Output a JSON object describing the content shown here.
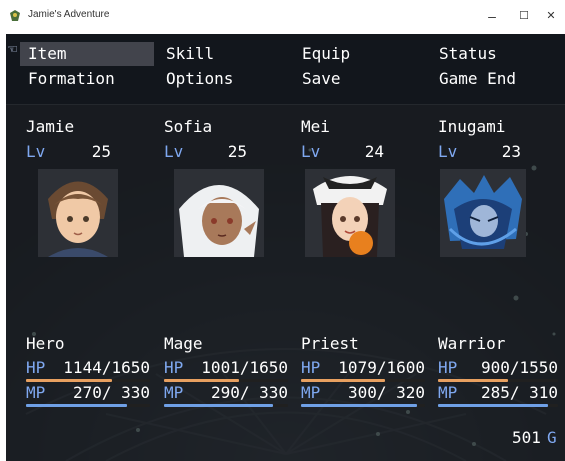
{
  "window": {
    "title": "Jamie's Adventure",
    "controls": {
      "minimize": "–",
      "maximize": "☐",
      "close": "✕"
    }
  },
  "commands": [
    {
      "label": "Item",
      "selected": true
    },
    {
      "label": "Skill",
      "selected": false
    },
    {
      "label": "Equip",
      "selected": false
    },
    {
      "label": "Status",
      "selected": false
    },
    {
      "label": "Formation",
      "selected": false
    },
    {
      "label": "Options",
      "selected": false
    },
    {
      "label": "Save",
      "selected": false
    },
    {
      "label": "Game End",
      "selected": false
    }
  ],
  "party": [
    {
      "name": "Jamie",
      "level_label": "Lv",
      "level": "25",
      "class": "Hero",
      "hp_label": "HP",
      "hp": "1144/1650",
      "mp_label": "MP",
      "mp": "270/ 330",
      "hp_fill": 0.693,
      "mp_fill": 0.818,
      "portrait": "jamie-portrait"
    },
    {
      "name": "Sofia",
      "level_label": "Lv",
      "level": "25",
      "class": "Mage",
      "hp_label": "HP",
      "hp": "1001/1650",
      "mp_label": "MP",
      "mp": "290/ 330",
      "hp_fill": 0.607,
      "mp_fill": 0.879,
      "portrait": "sofia-portrait"
    },
    {
      "name": "Mei",
      "level_label": "Lv",
      "level": "24",
      "class": "Priest",
      "hp_label": "HP",
      "hp": "1079/1600",
      "mp_label": "MP",
      "mp": "300/ 320",
      "hp_fill": 0.674,
      "mp_fill": 0.938,
      "portrait": "mei-portrait"
    },
    {
      "name": "Inugami",
      "level_label": "Lv",
      "level": "23",
      "class": "Warrior",
      "hp_label": "HP",
      "hp": "900/1550",
      "mp_label": "MP",
      "mp": "285/ 310",
      "hp_fill": 0.581,
      "mp_fill": 0.919,
      "portrait": "inugami-portrait"
    }
  ],
  "gold": {
    "amount": "501",
    "unit": "G"
  },
  "colors": {
    "system_text": "#7fa8f0",
    "hp_gauge": "#e8a060",
    "mp_gauge": "#6fa0e6",
    "gauge_back": "#202020"
  }
}
